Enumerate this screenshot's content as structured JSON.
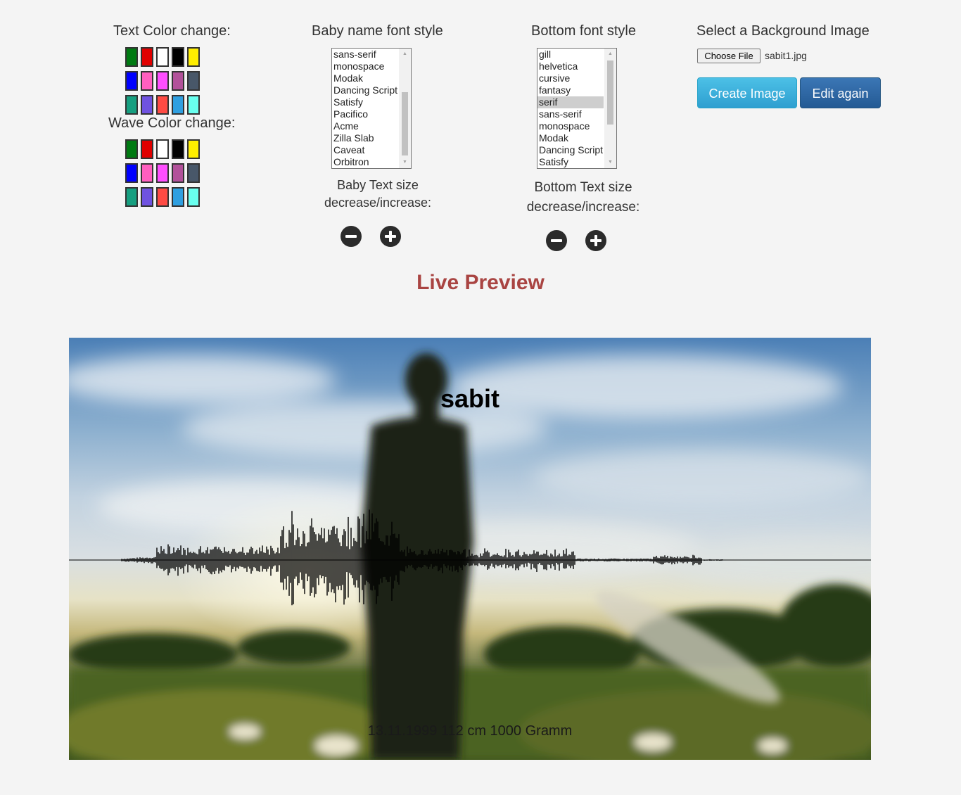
{
  "text_color": {
    "title": "Text Color change:",
    "swatches": [
      "#007a12",
      "#e00000",
      "#ffffff",
      "#000000",
      "#ffee00",
      "#0000ff",
      "#ff5fbf",
      "#ff4eff",
      "#b2519a",
      "#485769",
      "#169f80",
      "#6f52e0",
      "#ff4b44",
      "#2f9fe0",
      "#69ffef"
    ]
  },
  "wave_color": {
    "title": "Wave Color change:",
    "swatches": [
      "#007a12",
      "#e00000",
      "#ffffff",
      "#000000",
      "#ffee00",
      "#0000ff",
      "#ff5fbf",
      "#ff4eff",
      "#b2519a",
      "#485769",
      "#169f80",
      "#6f52e0",
      "#ff4b44",
      "#2f9fe0",
      "#69ffef"
    ]
  },
  "baby_font": {
    "title": "Baby name font style",
    "options": [
      "sans-serif",
      "monospace",
      "Modak",
      "Dancing Script",
      "Satisfy",
      "Pacifico",
      "Acme",
      "Zilla Slab",
      "Caveat",
      "Orbitron"
    ],
    "size_label_1": "Baby Text size",
    "size_label_2": "decrease/increase:"
  },
  "bottom_font": {
    "title": "Bottom font style",
    "options": [
      "gill",
      "helvetica",
      "cursive",
      "fantasy",
      "serif",
      "sans-serif",
      "monospace",
      "Modak",
      "Dancing Script",
      "Satisfy"
    ],
    "selected": "serif",
    "size_label_1": "Bottom Text size",
    "size_label_2": "decrease/increase:"
  },
  "background": {
    "title": "Select a Background Image",
    "choose_label": "Choose File",
    "file_name": "sabit1.jpg"
  },
  "buttons": {
    "create": "Create Image",
    "edit": "Edit again"
  },
  "preview": {
    "title": "Live Preview",
    "baby_name": "sabit",
    "bottom_text": "13.11.1999  112 cm  1000 Gramm"
  }
}
